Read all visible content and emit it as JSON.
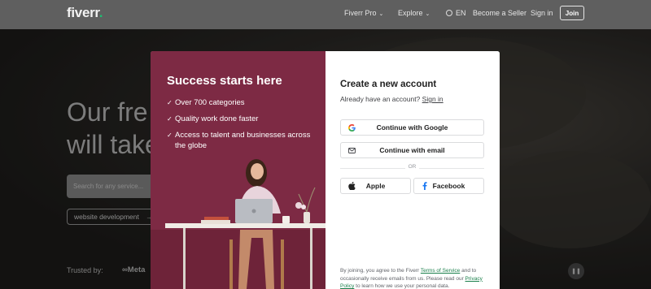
{
  "nav": {
    "logo": "fiverr",
    "logo_dot": ".",
    "fiverr_pro": "Fiverr Pro",
    "explore": "Explore",
    "language": "EN",
    "become_seller": "Become a Seller",
    "sign_in": "Sign in",
    "join": "Join"
  },
  "hero": {
    "title_line1": "Our fre",
    "title_line2": "will take",
    "search_placeholder": "Search for any service...",
    "chip": "website development",
    "trusted_by": "Trusted by:",
    "meta": "Meta"
  },
  "modal": {
    "left": {
      "title": "Success starts here",
      "benefits": [
        "Over 700 categories",
        "Quality work done faster",
        "Access to talent and businesses across the globe"
      ]
    },
    "right": {
      "title": "Create a new account",
      "have_account": "Already have an account?",
      "sign_in": "Sign in",
      "google": "Continue with Google",
      "email": "Continue with email",
      "or": "OR",
      "apple": "Apple",
      "facebook": "Facebook",
      "terms_1": "By joining, you agree to the Fiverr ",
      "terms_link": "Terms of Service",
      "terms_2": " and to occasionally receive emails from us. Please read our ",
      "privacy_link": "Privacy Policy",
      "terms_3": " to learn how we use your personal data."
    }
  },
  "colors": {
    "brand_green": "#1dbf73",
    "panel_maroon": "#7d2a44",
    "link_green": "#1a7f4b"
  }
}
